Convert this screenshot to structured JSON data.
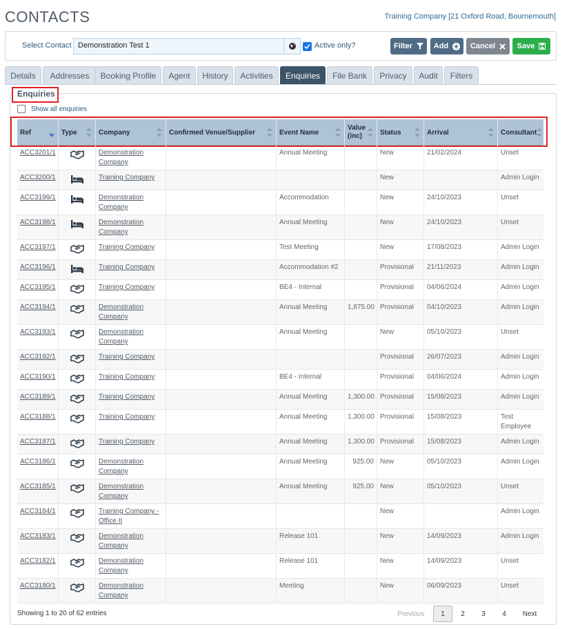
{
  "header": {
    "title": "CONTACTS",
    "company": "Training Company [21 Oxford Road, Bournemouth]"
  },
  "contact": {
    "label": "Select Contact",
    "value": "Demonstration Test 1",
    "active_label": "Active only?",
    "active_checked": true
  },
  "toolbar": {
    "filter": "Filter",
    "add": "Add",
    "cancel": "Cancel",
    "save": "Save"
  },
  "tabs": [
    "Details",
    "Addresses",
    "Booking Profile",
    "Agent",
    "History",
    "Activities",
    "Enquiries",
    "File Bank",
    "Privacy",
    "Audit",
    "Filters"
  ],
  "active_tab": "Enquiries",
  "enquiries": {
    "legend": "Enquiries",
    "show_all_label": "Show all enquiries",
    "columns": [
      "Ref",
      "Type",
      "Company",
      "Confirmed Venue/Supplier",
      "Event Name",
      "Value (inc)",
      "Status",
      "Arrival",
      "Consultant"
    ],
    "rows": [
      {
        "ref": "ACC3201/1",
        "type": "handshake",
        "company": "Demonstration Company",
        "venue": "",
        "event": "Annual Meeting",
        "value": "",
        "status": "New",
        "arrival": "21/02/2024",
        "consultant": "Unset"
      },
      {
        "ref": "ACC3200/1",
        "type": "bed",
        "company": "Training Company",
        "venue": "",
        "event": "",
        "value": "",
        "status": "New",
        "arrival": "",
        "consultant": "Admin Login"
      },
      {
        "ref": "ACC3199/1",
        "type": "bed",
        "company": "Demonstration Company",
        "venue": "",
        "event": "Accommodation",
        "value": "",
        "status": "New",
        "arrival": "24/10/2023",
        "consultant": "Unset"
      },
      {
        "ref": "ACC3198/1",
        "type": "bed",
        "company": "Demonstration Company",
        "venue": "",
        "event": "Annual Meeting",
        "value": "",
        "status": "New",
        "arrival": "24/10/2023",
        "consultant": "Unset"
      },
      {
        "ref": "ACC3197/1",
        "type": "handshake",
        "company": "Training Company",
        "venue": "",
        "event": "Test Meeting",
        "value": "",
        "status": "New",
        "arrival": "17/08/2023",
        "consultant": "Admin Login"
      },
      {
        "ref": "ACC3196/1",
        "type": "bed",
        "company": "Training Company",
        "venue": "",
        "event": "Accommodation #2",
        "value": "",
        "status": "Provisional",
        "arrival": "21/11/2023",
        "consultant": "Admin Login"
      },
      {
        "ref": "ACC3195/1",
        "type": "handshake",
        "company": "Training Company",
        "venue": "",
        "event": "BE4 - Internal",
        "value": "",
        "status": "Provisional",
        "arrival": "04/06/2024",
        "consultant": "Admin Login"
      },
      {
        "ref": "ACC3194/1",
        "type": "handshake",
        "company": "Demonstration Company",
        "venue": "",
        "event": "Annual Meeting",
        "value": "1,875.00",
        "status": "Provisional",
        "arrival": "04/10/2023",
        "consultant": "Admin Login"
      },
      {
        "ref": "ACC3193/1",
        "type": "handshake",
        "company": "Demonstration Company",
        "venue": "",
        "event": "Annual Meeting",
        "value": "",
        "status": "New",
        "arrival": "05/10/2023",
        "consultant": "Unset"
      },
      {
        "ref": "ACC3192/1",
        "type": "handshake",
        "company": "Training Company",
        "venue": "",
        "event": "",
        "value": "",
        "status": "Provisional",
        "arrival": "26/07/2023",
        "consultant": "Admin Login"
      },
      {
        "ref": "ACC3190/1",
        "type": "handshake",
        "company": "Training Company",
        "venue": "",
        "event": "BE4 - Internal",
        "value": "",
        "status": "Provisional",
        "arrival": "04/06/2024",
        "consultant": "Admin Login"
      },
      {
        "ref": "ACC3189/1",
        "type": "handshake",
        "company": "Training Company",
        "venue": "",
        "event": "Annual Meeting",
        "value": "1,300.00",
        "status": "Provisional",
        "arrival": "15/08/2023",
        "consultant": "Admin Login"
      },
      {
        "ref": "ACC3188/1",
        "type": "handshake",
        "company": "Training Company",
        "venue": "",
        "event": "Annual Meeting",
        "value": "1,300.00",
        "status": "Provisional",
        "arrival": "15/08/2023",
        "consultant": "Test Employee"
      },
      {
        "ref": "ACC3187/1",
        "type": "handshake",
        "company": "Training Company",
        "venue": "",
        "event": "Annual Meeting",
        "value": "1,300.00",
        "status": "Provisional",
        "arrival": "15/08/2023",
        "consultant": "Admin Login"
      },
      {
        "ref": "ACC3186/1",
        "type": "handshake",
        "company": "Demonstration Company",
        "venue": "",
        "event": "Annual Meeting",
        "value": "925.00",
        "status": "New",
        "arrival": "05/10/2023",
        "consultant": "Admin Login"
      },
      {
        "ref": "ACC3185/1",
        "type": "handshake",
        "company": "Demonstration Company",
        "venue": "",
        "event": "Annual Meeting",
        "value": "925.00",
        "status": "New",
        "arrival": "05/10/2023",
        "consultant": "Unset"
      },
      {
        "ref": "ACC3184/1",
        "type": "handshake",
        "company": "Training Company - Office II",
        "venue": "",
        "event": "",
        "value": "",
        "status": "New",
        "arrival": "",
        "consultant": "Admin Login"
      },
      {
        "ref": "ACC3183/1",
        "type": "handshake",
        "company": "Demonstration Company",
        "venue": "",
        "event": "Release 101",
        "value": "",
        "status": "New",
        "arrival": "14/09/2023",
        "consultant": "Admin Login"
      },
      {
        "ref": "ACC3182/1",
        "type": "handshake",
        "company": "Demonstration Company",
        "venue": "",
        "event": "Release 101",
        "value": "",
        "status": "New",
        "arrival": "14/09/2023",
        "consultant": "Unset"
      },
      {
        "ref": "ACC3180/1",
        "type": "handshake",
        "company": "Demonstration Company",
        "venue": "",
        "event": "Meeting",
        "value": "",
        "status": "New",
        "arrival": "06/09/2023",
        "consultant": "Unset"
      }
    ],
    "info": "Showing 1 to 20 of 62 entries",
    "pagination": {
      "previous": "Previous",
      "pages": [
        "1",
        "2",
        "3",
        "4"
      ],
      "current": "1",
      "next": "Next"
    }
  },
  "colors": {
    "accent": "#3c5468",
    "header_bg": "#aec3d6",
    "save": "#2bae4a",
    "highlight": "#e0201f"
  }
}
